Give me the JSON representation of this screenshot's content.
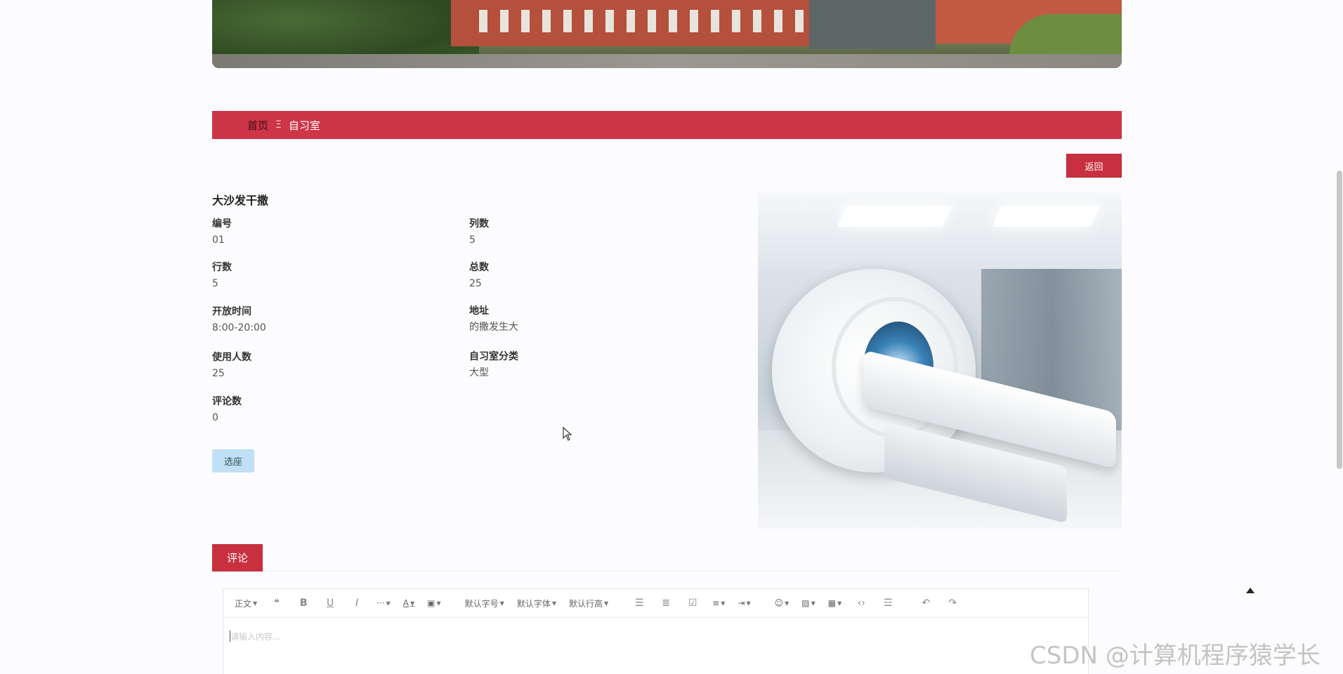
{
  "breadcrumb": {
    "home": "首页",
    "separator": "Ξ",
    "current": "自习室"
  },
  "back_button": "返回",
  "room": {
    "title": "大沙发干撒",
    "fields": [
      {
        "label": "编号",
        "value": "01"
      },
      {
        "label": "列数",
        "value": "5"
      },
      {
        "label": "行数",
        "value": "5"
      },
      {
        "label": "总数",
        "value": "25"
      },
      {
        "label": "开放时间",
        "value": "8:00-20:00"
      },
      {
        "label": "地址",
        "value": "的撒发生大"
      },
      {
        "label": "使用人数",
        "value": "25"
      },
      {
        "label": "自习室分类",
        "value": "大型"
      },
      {
        "label": "评论数",
        "value": "0"
      }
    ],
    "select_seat_button": "选座"
  },
  "comment": {
    "tab_label": "评论",
    "editor": {
      "toolbar": {
        "paragraph": "正文",
        "font_size": "默认字号",
        "font_family": "默认字体",
        "line_height": "默认行高"
      },
      "placeholder": "请输入内容..."
    }
  },
  "watermark": "CSDN @计算机程序猿学长"
}
